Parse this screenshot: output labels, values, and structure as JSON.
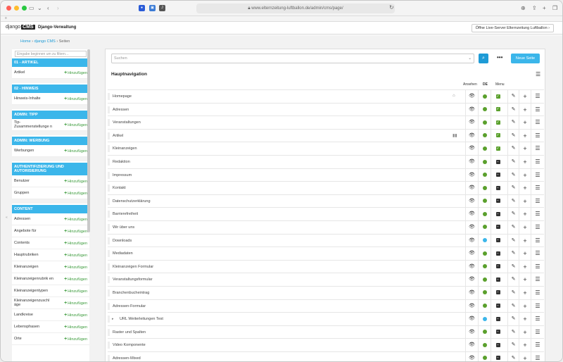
{
  "browser": {
    "url": "www.elternzeitung-luftballon.de/admin/cms/page/"
  },
  "cms": {
    "logo_text": "django",
    "logo_badge": "CMS",
    "title": "Django-Verwaltung",
    "live_button": "Öffne Live-Server Elternzeitung Luftballon"
  },
  "breadcrumb": {
    "home": "Home",
    "sep1": "›",
    "app": "django CMS",
    "sep2": "›",
    "current": "Seiten"
  },
  "sidebar": {
    "search_placeholder": "Eingabe beginnen um zu filtern…",
    "add_label": "Hinzufügen",
    "sections": [
      {
        "title": "01 - ARTIKEL",
        "items": [
          "Artikel"
        ]
      },
      {
        "title": "02 - HINWEIS",
        "items": [
          "Hinweis-Inhalte"
        ]
      },
      {
        "title": "ADMIN: TIPP",
        "items": [
          "Tip-Zusammenstellunge n"
        ]
      },
      {
        "title": "ADMIN: WERBUNG",
        "items": [
          "Werbungen"
        ]
      },
      {
        "title": "AUTHENTIFIZIERUNG UND AUTORISIERUNG",
        "items": [
          "Benutzer",
          "Gruppen"
        ]
      },
      {
        "title": "CONTENT",
        "items": [
          "Adressen",
          "Angebote für",
          "Contents",
          "Hauptrubriken",
          "Kleinanzeigen",
          "Kleinanzeigenrubrik en",
          "Kleinanzeigentypen",
          "Kleinanzeigenzuschl äge",
          "Landkreise",
          "Lebensphasen",
          "Orte"
        ]
      }
    ]
  },
  "main": {
    "search_placeholder": "Suchen",
    "search_icon": "search-icon",
    "more_label": "•••",
    "new_page_button": "Neue Seite",
    "tree_title": "Hauptnavigation",
    "columns": {
      "view": "Ansehen",
      "lang": "DE",
      "menu": "Menu"
    },
    "colors": {
      "published": "#5aa02c",
      "pending": "#3bb6ea",
      "menu_on": "#5aa02c",
      "menu_off": "#333333"
    },
    "pages": [
      {
        "name": "Homepage",
        "status": "published",
        "menu": true,
        "icon": "home"
      },
      {
        "name": "Adressen",
        "status": "published",
        "menu": true
      },
      {
        "name": "Veranstaltungen",
        "status": "published",
        "menu": true
      },
      {
        "name": "Artikel",
        "status": "published",
        "menu": true,
        "icon": "chart"
      },
      {
        "name": "Kleinanzeigen",
        "status": "published",
        "menu": true
      },
      {
        "name": "Redaktion",
        "status": "published",
        "menu": false
      },
      {
        "name": "Impressum",
        "status": "published",
        "menu": false
      },
      {
        "name": "Kontakt",
        "status": "published",
        "menu": false
      },
      {
        "name": "Datenschutzerklärung",
        "status": "published",
        "menu": false
      },
      {
        "name": "Barrierefreiheit",
        "status": "published",
        "menu": false
      },
      {
        "name": "Wir über uns",
        "status": "published",
        "menu": false
      },
      {
        "name": "Downloads",
        "status": "pending",
        "menu": false
      },
      {
        "name": "Mediadaten",
        "status": "published",
        "menu": false
      },
      {
        "name": "Kleinanzeigen Formular",
        "status": "published",
        "menu": false
      },
      {
        "name": "Veranstaltungsformular",
        "status": "published",
        "menu": false
      },
      {
        "name": "Branchenbucheintrag",
        "status": "published",
        "menu": false
      },
      {
        "name": "Adressen-Formular",
        "status": "published",
        "menu": false
      },
      {
        "name": "URL Weiterleitungen Test",
        "status": "pending",
        "menu": false,
        "expandable": true
      },
      {
        "name": "Raster und Spalten",
        "status": "published",
        "menu": false
      },
      {
        "name": "Video Komponente",
        "status": "published",
        "menu": false
      },
      {
        "name": "Adressen-Mixed",
        "status": "published",
        "menu": false
      }
    ]
  }
}
